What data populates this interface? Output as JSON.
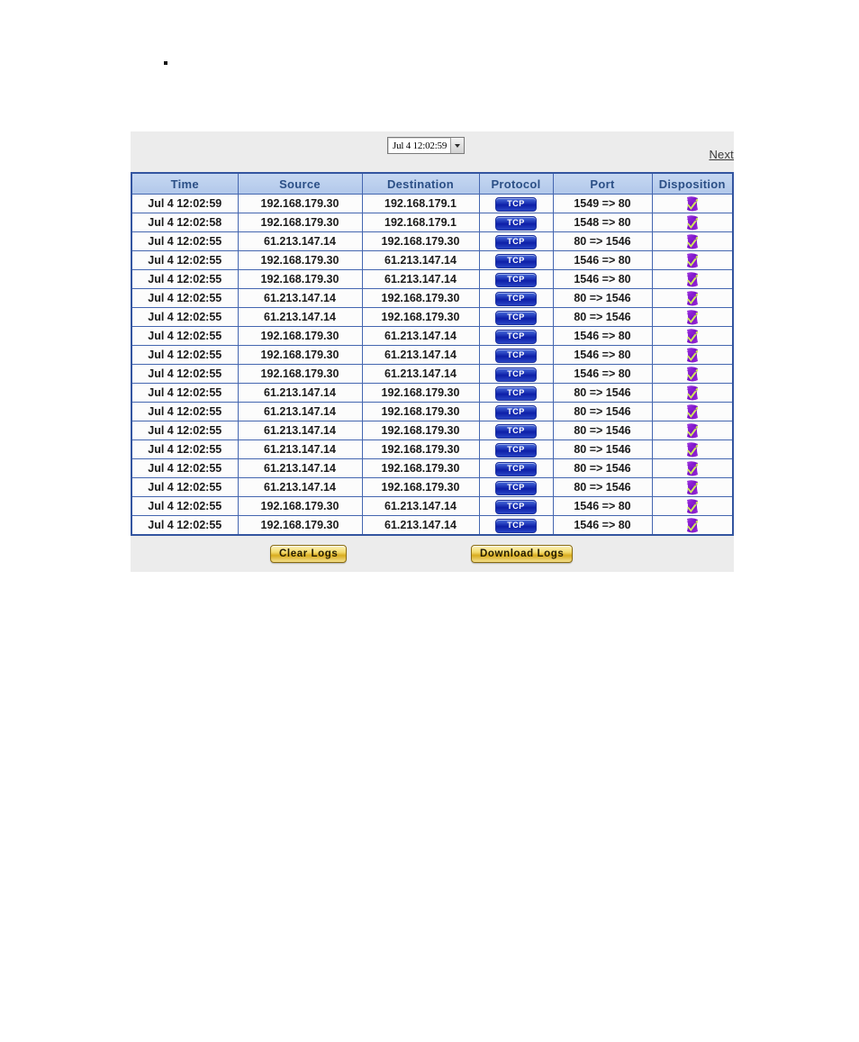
{
  "page": {
    "bullet": ""
  },
  "toolbar": {
    "time_selector": {
      "selected": "Jul 4 12:02:59",
      "icon": "chevron-down-icon",
      "options": [
        "Jul 4 12:02:59"
      ]
    },
    "next_link": "Next"
  },
  "table": {
    "columns": [
      "Time",
      "Source",
      "Destination",
      "Protocol",
      "Port",
      "Disposition"
    ],
    "header_bg": "#b2c8ea",
    "header_text_color": "#2b4f86",
    "border_color": "#3355a0",
    "protocol_badge_color": "#0d1fa8",
    "disposition_icon_name": "allowed-swirl-icon",
    "rows": [
      {
        "time": "Jul 4 12:02:59",
        "source": "192.168.179.30",
        "destination": "192.168.179.1",
        "protocol": "TCP",
        "port": "1549 => 80",
        "disposition": "allowed-swirl-icon"
      },
      {
        "time": "Jul 4 12:02:58",
        "source": "192.168.179.30",
        "destination": "192.168.179.1",
        "protocol": "TCP",
        "port": "1548 => 80",
        "disposition": "allowed-swirl-icon"
      },
      {
        "time": "Jul 4 12:02:55",
        "source": "61.213.147.14",
        "destination": "192.168.179.30",
        "protocol": "TCP",
        "port": "80 => 1546",
        "disposition": "allowed-swirl-icon"
      },
      {
        "time": "Jul 4 12:02:55",
        "source": "192.168.179.30",
        "destination": "61.213.147.14",
        "protocol": "TCP",
        "port": "1546 => 80",
        "disposition": "allowed-swirl-icon"
      },
      {
        "time": "Jul 4 12:02:55",
        "source": "192.168.179.30",
        "destination": "61.213.147.14",
        "protocol": "TCP",
        "port": "1546 => 80",
        "disposition": "allowed-swirl-icon"
      },
      {
        "time": "Jul 4 12:02:55",
        "source": "61.213.147.14",
        "destination": "192.168.179.30",
        "protocol": "TCP",
        "port": "80 => 1546",
        "disposition": "allowed-swirl-icon"
      },
      {
        "time": "Jul 4 12:02:55",
        "source": "61.213.147.14",
        "destination": "192.168.179.30",
        "protocol": "TCP",
        "port": "80 => 1546",
        "disposition": "allowed-swirl-icon"
      },
      {
        "time": "Jul 4 12:02:55",
        "source": "192.168.179.30",
        "destination": "61.213.147.14",
        "protocol": "TCP",
        "port": "1546 => 80",
        "disposition": "allowed-swirl-icon"
      },
      {
        "time": "Jul 4 12:02:55",
        "source": "192.168.179.30",
        "destination": "61.213.147.14",
        "protocol": "TCP",
        "port": "1546 => 80",
        "disposition": "allowed-swirl-icon"
      },
      {
        "time": "Jul 4 12:02:55",
        "source": "192.168.179.30",
        "destination": "61.213.147.14",
        "protocol": "TCP",
        "port": "1546 => 80",
        "disposition": "allowed-swirl-icon"
      },
      {
        "time": "Jul 4 12:02:55",
        "source": "61.213.147.14",
        "destination": "192.168.179.30",
        "protocol": "TCP",
        "port": "80 => 1546",
        "disposition": "allowed-swirl-icon"
      },
      {
        "time": "Jul 4 12:02:55",
        "source": "61.213.147.14",
        "destination": "192.168.179.30",
        "protocol": "TCP",
        "port": "80 => 1546",
        "disposition": "allowed-swirl-icon"
      },
      {
        "time": "Jul 4 12:02:55",
        "source": "61.213.147.14",
        "destination": "192.168.179.30",
        "protocol": "TCP",
        "port": "80 => 1546",
        "disposition": "allowed-swirl-icon"
      },
      {
        "time": "Jul 4 12:02:55",
        "source": "61.213.147.14",
        "destination": "192.168.179.30",
        "protocol": "TCP",
        "port": "80 => 1546",
        "disposition": "allowed-swirl-icon"
      },
      {
        "time": "Jul 4 12:02:55",
        "source": "61.213.147.14",
        "destination": "192.168.179.30",
        "protocol": "TCP",
        "port": "80 => 1546",
        "disposition": "allowed-swirl-icon"
      },
      {
        "time": "Jul 4 12:02:55",
        "source": "61.213.147.14",
        "destination": "192.168.179.30",
        "protocol": "TCP",
        "port": "80 => 1546",
        "disposition": "allowed-swirl-icon"
      },
      {
        "time": "Jul 4 12:02:55",
        "source": "192.168.179.30",
        "destination": "61.213.147.14",
        "protocol": "TCP",
        "port": "1546 => 80",
        "disposition": "allowed-swirl-icon"
      },
      {
        "time": "Jul 4 12:02:55",
        "source": "192.168.179.30",
        "destination": "61.213.147.14",
        "protocol": "TCP",
        "port": "1546 => 80",
        "disposition": "allowed-swirl-icon"
      }
    ]
  },
  "buttons": {
    "clear_logs": "Clear Logs",
    "download_logs": "Download Logs"
  }
}
